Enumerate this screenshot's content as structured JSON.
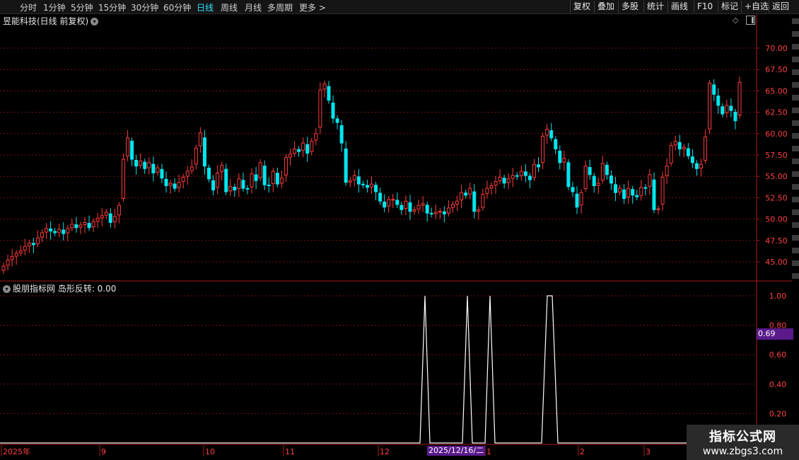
{
  "toolbar": {
    "periods": [
      "分时",
      "1分钟",
      "5分钟",
      "15分钟",
      "30分钟",
      "60分钟",
      "日线",
      "周线",
      "月线",
      "多周期",
      "更多 >"
    ],
    "active_period": "日线",
    "right_tabs": [
      "复权",
      "叠加",
      "多股",
      "统计",
      "画线",
      "F10",
      "标记",
      "+自选",
      "返回"
    ]
  },
  "stock": {
    "title": "昱能科技(日线 前复权)"
  },
  "indicator": {
    "label": "股朋指标网 岛形反转: 0.00",
    "cursor_value": "0.69"
  },
  "cursor_date": "2025/12/16/二",
  "watermark": {
    "title": "指标公式网",
    "url": "www.zbgs3.com"
  },
  "price_axis": [
    "70.00",
    "67.50",
    "65.00",
    "62.50",
    "60.00",
    "57.50",
    "55.00",
    "52.50",
    "50.00",
    "47.50",
    "45.00"
  ],
  "indicator_axis": [
    "1.00",
    "0.80",
    "0.60",
    "0.40",
    "0.20"
  ],
  "time_axis": [
    "2025年",
    "9",
    "10",
    "11",
    "12",
    "1",
    "2",
    "3"
  ],
  "colors": {
    "up": "#ff3c3c",
    "down": "#00e5ee",
    "grid": "#7a1010",
    "line": "#ffffff",
    "accent": "#33e0ff",
    "marker": "#5a1a8c"
  },
  "chart_data": {
    "type": "candlestick",
    "ylim": [
      43.5,
      72
    ],
    "closes": [
      44.5,
      45.2,
      45.6,
      46.0,
      46.3,
      46.8,
      47.2,
      47.0,
      47.8,
      48.4,
      48.9,
      48.6,
      48.4,
      48.8,
      48.3,
      48.9,
      49.4,
      49.0,
      49.3,
      49.6,
      49.0,
      49.7,
      50.1,
      50.4,
      50.8,
      49.6,
      50.3,
      51.6,
      57.0,
      59.5,
      57.0,
      56.2,
      56.8,
      55.9,
      56.6,
      55.4,
      56.0,
      54.8,
      53.9,
      54.2,
      53.6,
      54.3,
      54.9,
      55.6,
      56.1,
      58.3,
      60.1,
      56.2,
      54.7,
      53.4,
      55.4,
      56.3,
      53.2,
      53.8,
      53.4,
      54.7,
      53.6,
      53.5,
      55.3,
      54.5,
      56.6,
      54.0,
      53.9,
      55.6,
      54.1,
      54.8,
      57.2,
      57.6,
      58.2,
      57.9,
      58.9,
      57.7,
      59.1,
      60.0,
      65.1,
      65.8,
      63.9,
      61.8,
      61.3,
      58.9,
      54.3,
      54.5,
      55.1,
      54.1,
      54.0,
      53.7,
      54.1,
      53.2,
      52.1,
      51.4,
      52.3,
      52.3,
      51.7,
      51.1,
      52.1,
      50.9,
      51.1,
      51.6,
      51.8,
      50.7,
      50.6,
      50.8,
      50.9,
      50.6,
      51.3,
      51.7,
      52.1,
      53.1,
      52.8,
      53.6,
      50.9,
      51.1,
      52.9,
      53.6,
      53.9,
      54.4,
      54.9,
      54.2,
      54.7,
      55.1,
      55.0,
      55.6,
      55.1,
      54.6,
      56.4,
      56.1,
      59.7,
      60.5,
      59.5,
      58.2,
      56.6,
      57.1,
      53.8,
      53.2,
      51.4,
      53.1,
      56.2,
      55.2,
      53.9,
      54.2,
      56.5,
      55.2,
      54.2,
      53.1,
      53.6,
      52.4,
      53.6,
      52.8,
      52.6,
      53.7,
      53.6,
      55.2,
      51.1,
      51.2,
      54.9,
      56.2,
      58.6,
      59.1,
      58.2,
      58.4,
      57.4,
      56.6,
      55.9,
      56.4,
      59.6,
      65.9,
      64.6,
      63.3,
      62.3,
      63.3,
      62.7,
      61.5,
      66.0
    ]
  }
}
